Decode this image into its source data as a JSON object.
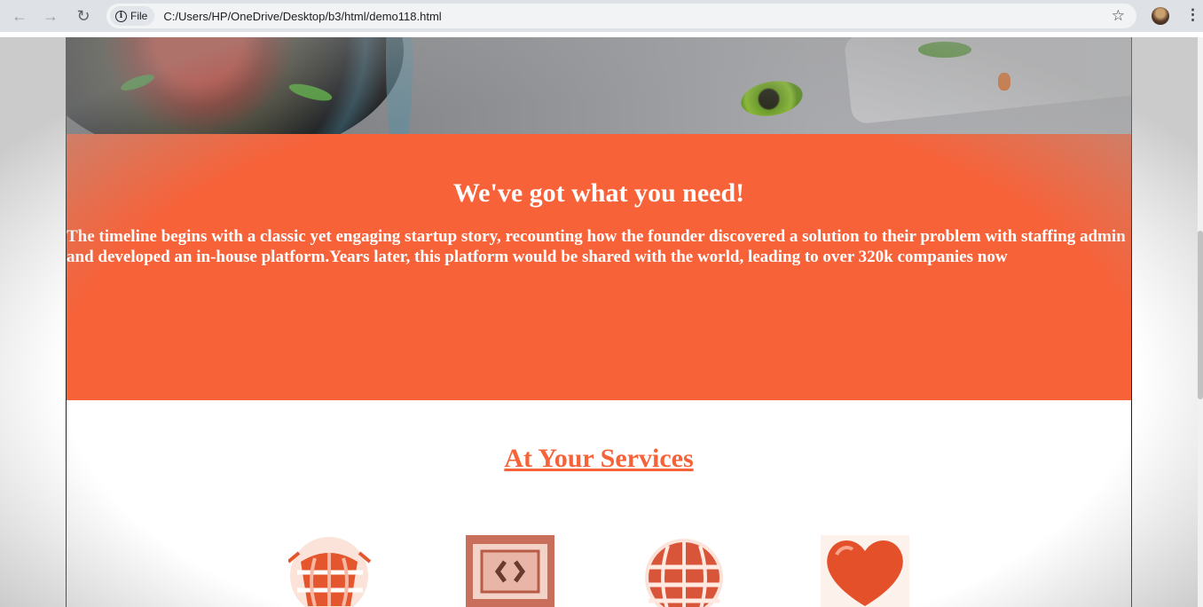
{
  "browser": {
    "chip_label": "File",
    "url": "C:/Users/HP/OneDrive/Desktop/b3/html/demo118.html"
  },
  "need_section": {
    "title": "We've got what you need!",
    "text": "The timeline begins with a classic yet engaging startup story, recounting how the founder discovered a solution to their problem with staffing admin and developed an in-house platform.Years later, this platform would be shared with the world, leading to over 320k companies now"
  },
  "services": {
    "title": "At Your Services",
    "icons": [
      "globe-icon",
      "code-icon",
      "world-grid-icon",
      "heart-icon"
    ]
  },
  "colors": {
    "accent": "#f76239",
    "chrome": "#dee1e6"
  }
}
